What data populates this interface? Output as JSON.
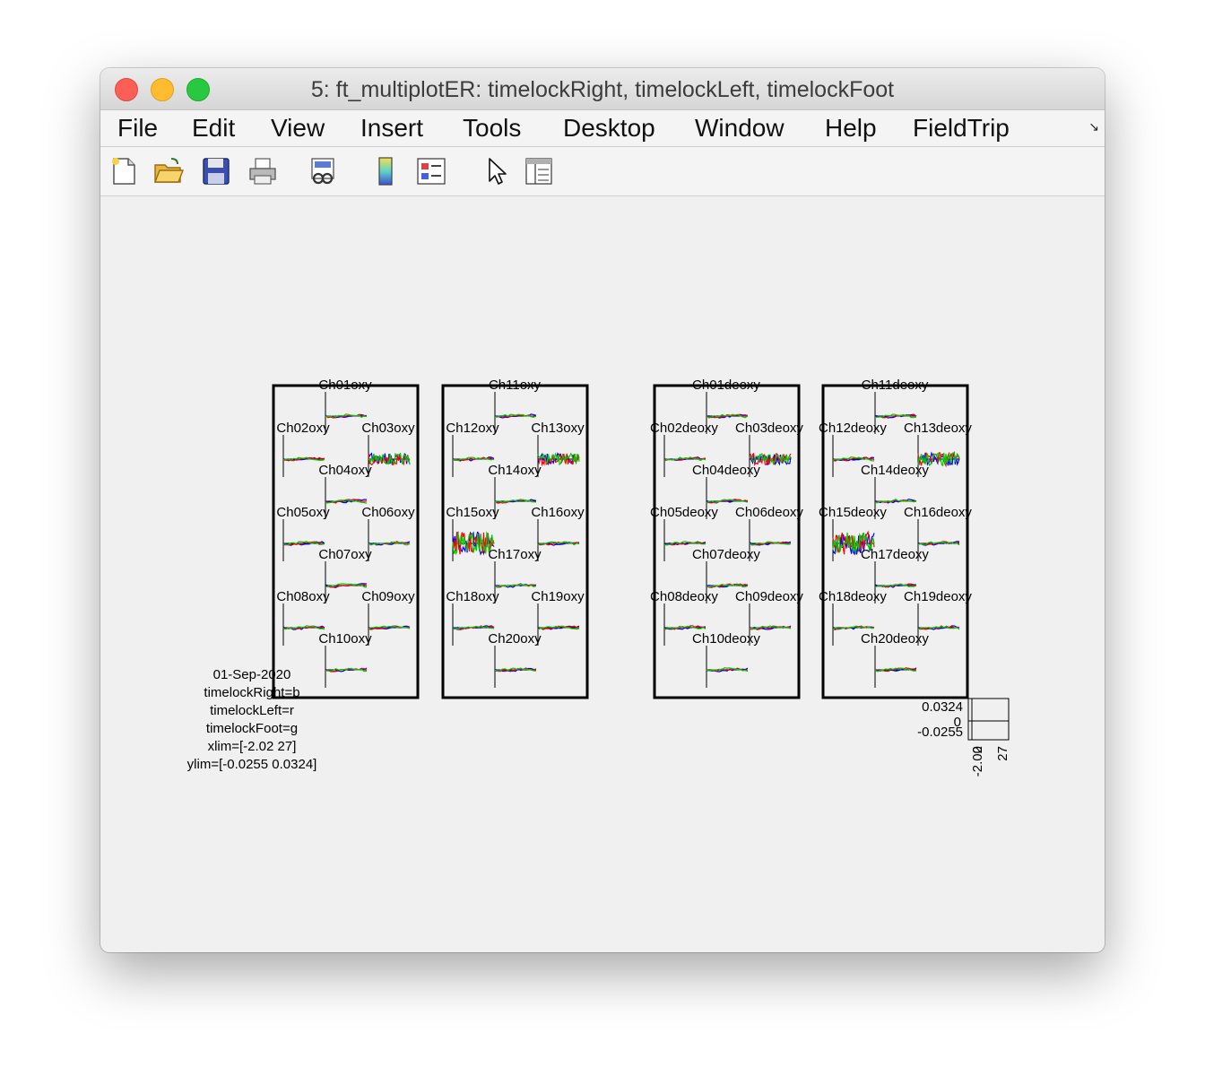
{
  "window": {
    "title": "5: ft_multiplotER: timelockRight, timelockLeft, timelockFoot"
  },
  "menu": [
    "File",
    "Edit",
    "View",
    "Insert",
    "Tools",
    "Desktop",
    "Window",
    "Help",
    "FieldTrip"
  ],
  "toolbar": {
    "icons": [
      "new-figure-icon",
      "open-file-icon",
      "save-icon",
      "print-icon",
      "link-plot-icon",
      "colorbar-icon",
      "legend-icon",
      "pointer-icon",
      "property-editor-icon"
    ]
  },
  "colors": {
    "timelockRight": "#0000ff",
    "timelockLeft": "#ff0000",
    "timelockFoot": "#00cc00",
    "axes": "#000000",
    "figure_bg": "#f0f0f0"
  },
  "channels": {
    "oxy": [
      "Ch01oxy",
      "Ch02oxy",
      "Ch03oxy",
      "Ch04oxy",
      "Ch05oxy",
      "Ch06oxy",
      "Ch07oxy",
      "Ch08oxy",
      "Ch09oxy",
      "Ch10oxy",
      "Ch11oxy",
      "Ch12oxy",
      "Ch13oxy",
      "Ch14oxy",
      "Ch15oxy",
      "Ch16oxy",
      "Ch17oxy",
      "Ch18oxy",
      "Ch19oxy",
      "Ch20oxy"
    ],
    "deoxy": [
      "Ch01deoxy",
      "Ch02deoxy",
      "Ch03deoxy",
      "Ch04deoxy",
      "Ch05deoxy",
      "Ch06deoxy",
      "Ch07deoxy",
      "Ch08deoxy",
      "Ch09deoxy",
      "Ch10deoxy",
      "Ch11deoxy",
      "Ch12deoxy",
      "Ch13deoxy",
      "Ch14deoxy",
      "Ch15deoxy",
      "Ch16deoxy",
      "Ch17deoxy",
      "Ch18deoxy",
      "Ch19deoxy",
      "Ch20deoxy"
    ]
  },
  "info": [
    "01-Sep-2020",
    "timelockRight=b",
    "timelockLeft=r",
    "timelockFoot=g",
    "xlim=[-2.02 27]",
    "ylim=[-0.0255 0.0324]"
  ],
  "scale": {
    "ymax": "0.0324",
    "yzero": "0",
    "ymin": "-0.0255",
    "xmin": "-2.02",
    "xzero": "0",
    "xmax": "27"
  },
  "chart_data": {
    "type": "line",
    "series": [
      {
        "name": "timelockRight"
      },
      {
        "name": "timelockLeft"
      },
      {
        "name": "timelockFoot"
      }
    ],
    "xlim": [
      -2.02,
      27
    ],
    "ylim": [
      -0.0255,
      0.0324
    ]
  }
}
